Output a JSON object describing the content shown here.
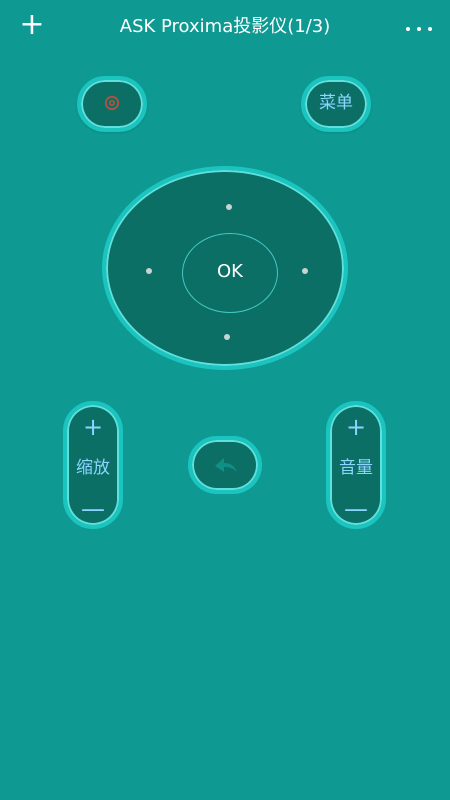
{
  "header": {
    "add_icon": "plus-icon",
    "add_symbol": "+",
    "title": "ASK Proxima投影仪(1/3)",
    "more_icon": "more-horizontal-icon"
  },
  "controls": {
    "power_icon": "power-icon",
    "menu_label": "菜单",
    "ok_label": "OK",
    "zoom_label": "缩放",
    "volume_label": "音量",
    "plus_symbol": "+",
    "minus_symbol": "—",
    "back_icon": "back-arrow-icon"
  },
  "colors": {
    "background": "#0e9a93",
    "button_fill": "#0b6f66",
    "button_border": "#1ac4bf",
    "accent_text": "#8bd5ff",
    "power_red": "#b6523d",
    "title_text": "#ffffff"
  }
}
